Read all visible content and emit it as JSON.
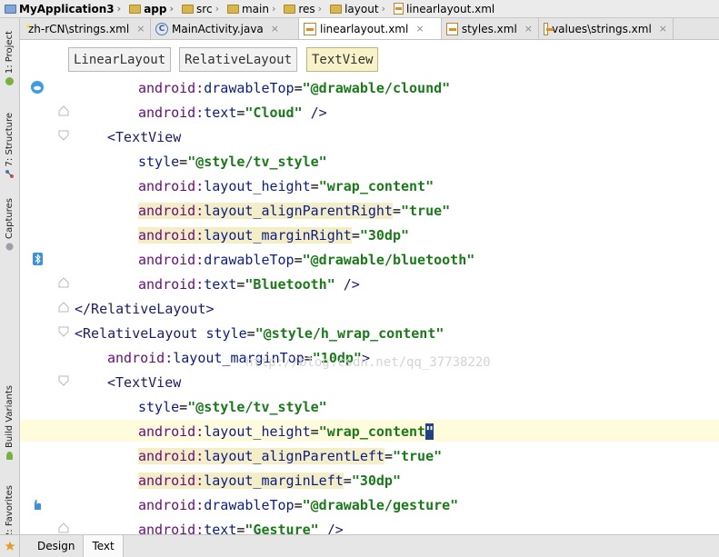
{
  "breadcrumbs": [
    "MyApplication3",
    "app",
    "src",
    "main",
    "res",
    "layout",
    "linearlayout.xml"
  ],
  "tabs": [
    {
      "label": "zh-rCN\\strings.xml",
      "icon": "flag-cn-icon",
      "active": false
    },
    {
      "label": "MainActivity.java",
      "icon": "class-icon",
      "active": false
    },
    {
      "label": "linearlayout.xml",
      "icon": "xml-file-icon",
      "active": true
    },
    {
      "label": "styles.xml",
      "icon": "xml-file-icon",
      "active": false
    },
    {
      "label": "values\\strings.xml",
      "icon": "xml-file-icon",
      "active": false
    }
  ],
  "tab_close_glyph": "×",
  "sidebar": {
    "project": "1: Project",
    "structure": "7: Structure",
    "captures": "Captures",
    "build_variants": "Build Variants",
    "favorites": "2: Favorites"
  },
  "preview_buttons": [
    "LinearLayout",
    "RelativeLayout",
    "TextView"
  ],
  "code_lines": [
    "android:drawableTop=\"@drawable/clound\"",
    "android:text=\"Cloud\" />",
    "<TextView",
    "style=\"@style/tv_style\"",
    "android:layout_height=\"wrap_content\"",
    "android:layout_alignParentRight=\"true\"",
    "android:layout_marginRight=\"30dp\"",
    "android:drawableTop=\"@drawable/bluetooth\"",
    "android:text=\"Bluetooth\" />",
    "</RelativeLayout>",
    "<RelativeLayout style=\"@style/h_wrap_content\"",
    "android:layout_marginTop=\"10dp\">",
    "<TextView",
    "style=\"@style/tv_style\"",
    "android:layout_height=\"wrap_content\"",
    "android:layout_alignParentLeft=\"true\"",
    "android:layout_marginLeft=\"30dp\"",
    "android:drawableTop=\"@drawable/gesture\"",
    "android:text=\"Gesture\" />"
  ],
  "watermark": "http://blog.csdn.net/qq_37738220",
  "bottom_tabs": [
    "Design",
    "Text"
  ],
  "colors": {
    "attribute": "#0b1c8a",
    "value": "#1a7a1a",
    "namespace": "#660e7a",
    "caret_line": "#fffbdc"
  }
}
